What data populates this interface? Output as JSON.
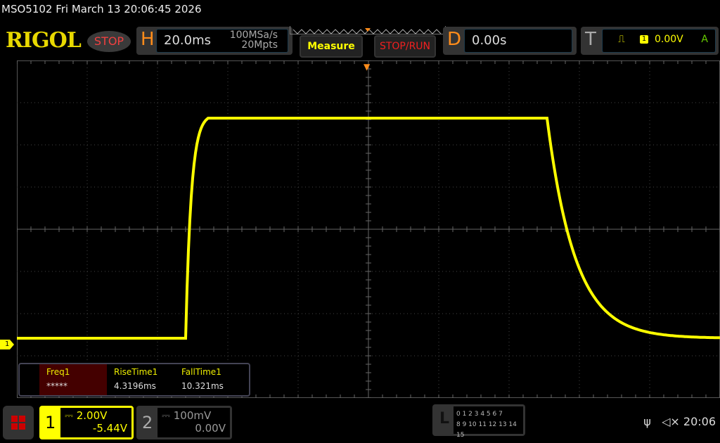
{
  "header": {
    "title": "MSO5102  Fri March 13 20:06:45 2026",
    "logo": "RIGOL",
    "run_state": "STOP"
  },
  "horizontal": {
    "letter": "H",
    "timebase": "20.0ms",
    "sample_rate": "100MSa/s",
    "memory_depth": "20Mpts"
  },
  "buttons": {
    "measure": "Measure",
    "stop_run": "STOP/RUN"
  },
  "delay": {
    "letter": "D",
    "value": "0.00s"
  },
  "trigger": {
    "letter": "T",
    "edge_icon": "rising-edge-icon",
    "source": "1",
    "level": "0.00V",
    "mode": "A"
  },
  "measurements": [
    {
      "name": "Freq1",
      "value": "*****"
    },
    {
      "name": "RiseTime1",
      "value": "4.3196ms"
    },
    {
      "name": "FallTime1",
      "value": "10.321ms"
    }
  ],
  "channels": [
    {
      "number": "1",
      "scale": "2.00V",
      "offset": "-5.44V",
      "coupling_icon": "dc-coupling-icon",
      "color": "#ffff00",
      "active": true
    },
    {
      "number": "2",
      "scale": "100mV",
      "offset": "0.00V",
      "coupling_icon": "dc-coupling-icon",
      "color": "#999999",
      "active": false
    }
  ],
  "logic": {
    "letter": "L",
    "row1": "0 1 2 3  4 5 6 7",
    "row2": "8 9 10 11 12 13 14 15"
  },
  "status": {
    "usb_icon": "usb-icon",
    "mute_icon": "speaker-muted-icon",
    "time": "20:06"
  },
  "markers": {
    "ch1": "1",
    "trigger": "T"
  },
  "colors": {
    "ch1": "#ffff00",
    "accent": "#ff8c1a",
    "stop": "#f04040"
  }
}
